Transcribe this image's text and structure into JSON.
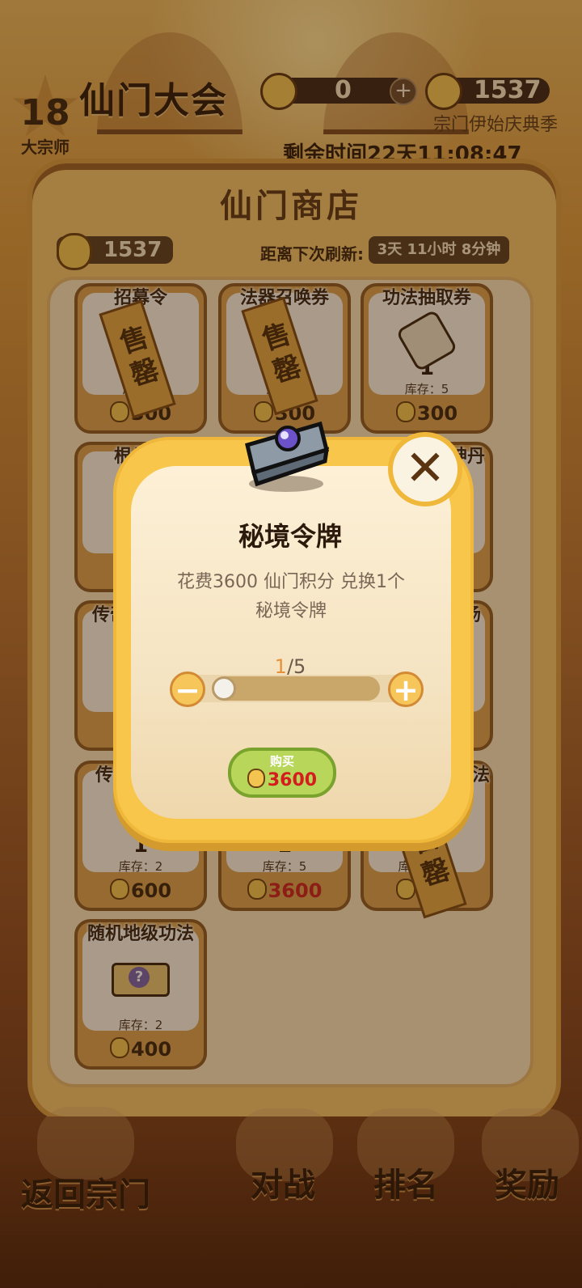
{
  "header": {
    "level": "18",
    "level_title": "大宗师",
    "title": "仙门大会",
    "token_value": "0",
    "token_plus": "+",
    "points_value": "1537",
    "season": "宗门伊始庆典季",
    "remaining_time": "剩余时间22天11:08:47"
  },
  "shop": {
    "title": "仙门商店",
    "coins": "1537",
    "refresh_label": "距离下次刷新:",
    "refresh_time": "3天 11小时 8分钟",
    "items": [
      {
        "name": "招募令",
        "stock": "库存：",
        "price": "300",
        "sold": "售罄"
      },
      {
        "name": "法器召唤券",
        "stock": "库存：",
        "price": "300",
        "sold": "售罄"
      },
      {
        "name": "功法抽取券",
        "qty": "1",
        "stock": "库存：5",
        "price": "300"
      },
      {
        "name": "根骨丹"
      },
      {
        "name": "神丹"
      },
      {
        "name": "传奇"
      },
      {
        "name": "汤"
      },
      {
        "name": "传奇",
        "qty": "1",
        "stock": "库存：2",
        "price": "600"
      },
      {
        "name": "",
        "qty": "1",
        "stock": "库存：5",
        "price": "3600"
      },
      {
        "name": "功法",
        "stock": "库",
        "price": "600",
        "sold": "售罄"
      },
      {
        "name": "随机地级功法",
        "stock": "库存：2",
        "price": "400"
      }
    ]
  },
  "bottom_nav": {
    "back": "返回宗门",
    "battle": "对战",
    "rank": "排名",
    "reward": "奖励"
  },
  "modal": {
    "item_icon": "ring-icon",
    "title": "秘境令牌",
    "desc_line1": "花费3600 仙门积分 兑换1个",
    "desc_line2": "秘境令牌",
    "qty_current": "1",
    "qty_max": "/5",
    "slider_fraction": 0.2,
    "minus": "−",
    "plus": "+",
    "buy_label": "购买",
    "buy_price": "3600",
    "close": "✕"
  }
}
